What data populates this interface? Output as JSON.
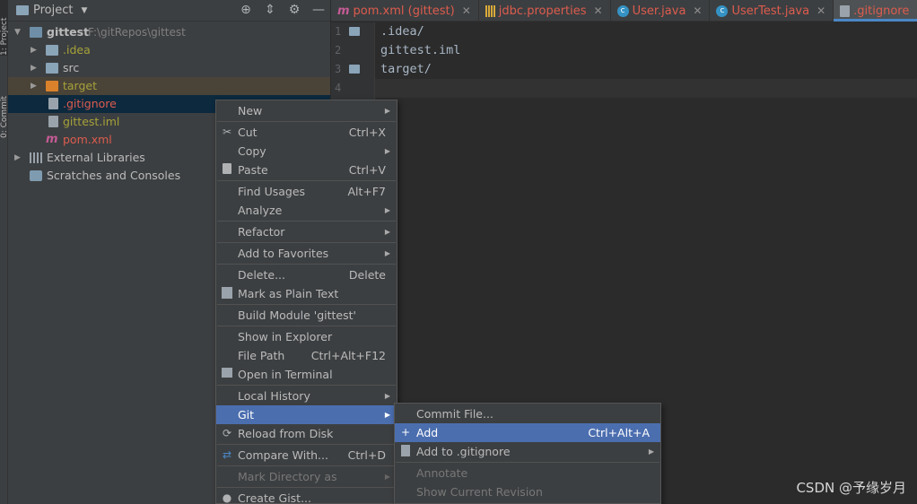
{
  "stripe": {
    "project_tab": "1: Project",
    "commit_tab": "0: Commit"
  },
  "panel": {
    "title": "Project",
    "tree": [
      {
        "label": "gittest",
        "path": "F:\\gitRepos\\gittest"
      },
      {
        "label": ".idea"
      },
      {
        "label": "src"
      },
      {
        "label": "target"
      },
      {
        "label": ".gitignore"
      },
      {
        "label": "gittest.iml"
      },
      {
        "label": "pom.xml"
      },
      {
        "label": "External Libraries"
      },
      {
        "label": "Scratches and Consoles"
      }
    ]
  },
  "tabs": [
    {
      "label": "pom.xml (gittest)",
      "icon": "maven-icon"
    },
    {
      "label": "jdbc.properties",
      "icon": "properties-icon"
    },
    {
      "label": "User.java",
      "icon": "class-icon"
    },
    {
      "label": "UserTest.java",
      "icon": "class-icon"
    },
    {
      "label": ".gitignore",
      "icon": "gitignore-icon"
    }
  ],
  "editor": {
    "line_numbers": [
      "1",
      "2",
      "3",
      "4"
    ],
    "lines": [
      ".idea/",
      "gittest.iml",
      "target/",
      ""
    ]
  },
  "context_menu": {
    "new": "New",
    "cut": "Cut",
    "cut_key": "Ctrl+X",
    "copy": "Copy",
    "paste": "Paste",
    "paste_key": "Ctrl+V",
    "find_usages": "Find Usages",
    "find_usages_key": "Alt+F7",
    "analyze": "Analyze",
    "refactor": "Refactor",
    "add_to_favorites": "Add to Favorites",
    "delete": "Delete...",
    "delete_key": "Delete",
    "mark_plain": "Mark as Plain Text",
    "build_module": "Build Module 'gittest'",
    "show_in_explorer": "Show in Explorer",
    "file_path": "File Path",
    "file_path_key": "Ctrl+Alt+F12",
    "open_terminal": "Open in Terminal",
    "local_history": "Local History",
    "git": "Git",
    "reload": "Reload from Disk",
    "compare": "Compare With...",
    "compare_key": "Ctrl+D",
    "mark_directory": "Mark Directory as",
    "create_gist": "Create Gist..."
  },
  "git_submenu": {
    "commit_file": "Commit File...",
    "add": "Add",
    "add_key": "Ctrl+Alt+A",
    "add_to_gitignore": "Add to .gitignore",
    "annotate": "Annotate",
    "show_current_revision": "Show Current Revision"
  },
  "watermark": "CSDN @予缘岁月",
  "colors": {
    "selection": "#4b6eaf",
    "ignored": "#a6a23a",
    "untracked": "#dd5c4e",
    "tab_underline": "#4a88c7"
  }
}
